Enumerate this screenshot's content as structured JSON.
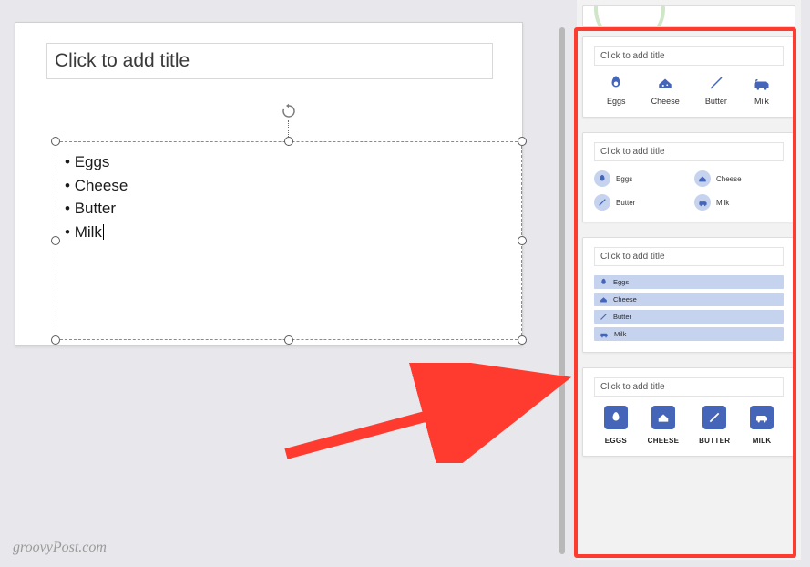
{
  "slide": {
    "title_placeholder": "Click to add title",
    "bullets": [
      "Eggs",
      "Cheese",
      "Butter",
      "Milk"
    ]
  },
  "design_ideas": {
    "common_title": "Click to add title",
    "items": [
      "Eggs",
      "Cheese",
      "Butter",
      "Milk"
    ],
    "items_upper": [
      "EGGS",
      "CHEESE",
      "BUTTER",
      "MILK"
    ]
  },
  "watermark": "groovyPost.com",
  "colors": {
    "accent": "#4566b8",
    "accent_light": "#c6d3ee",
    "highlight": "#ff3b30"
  }
}
